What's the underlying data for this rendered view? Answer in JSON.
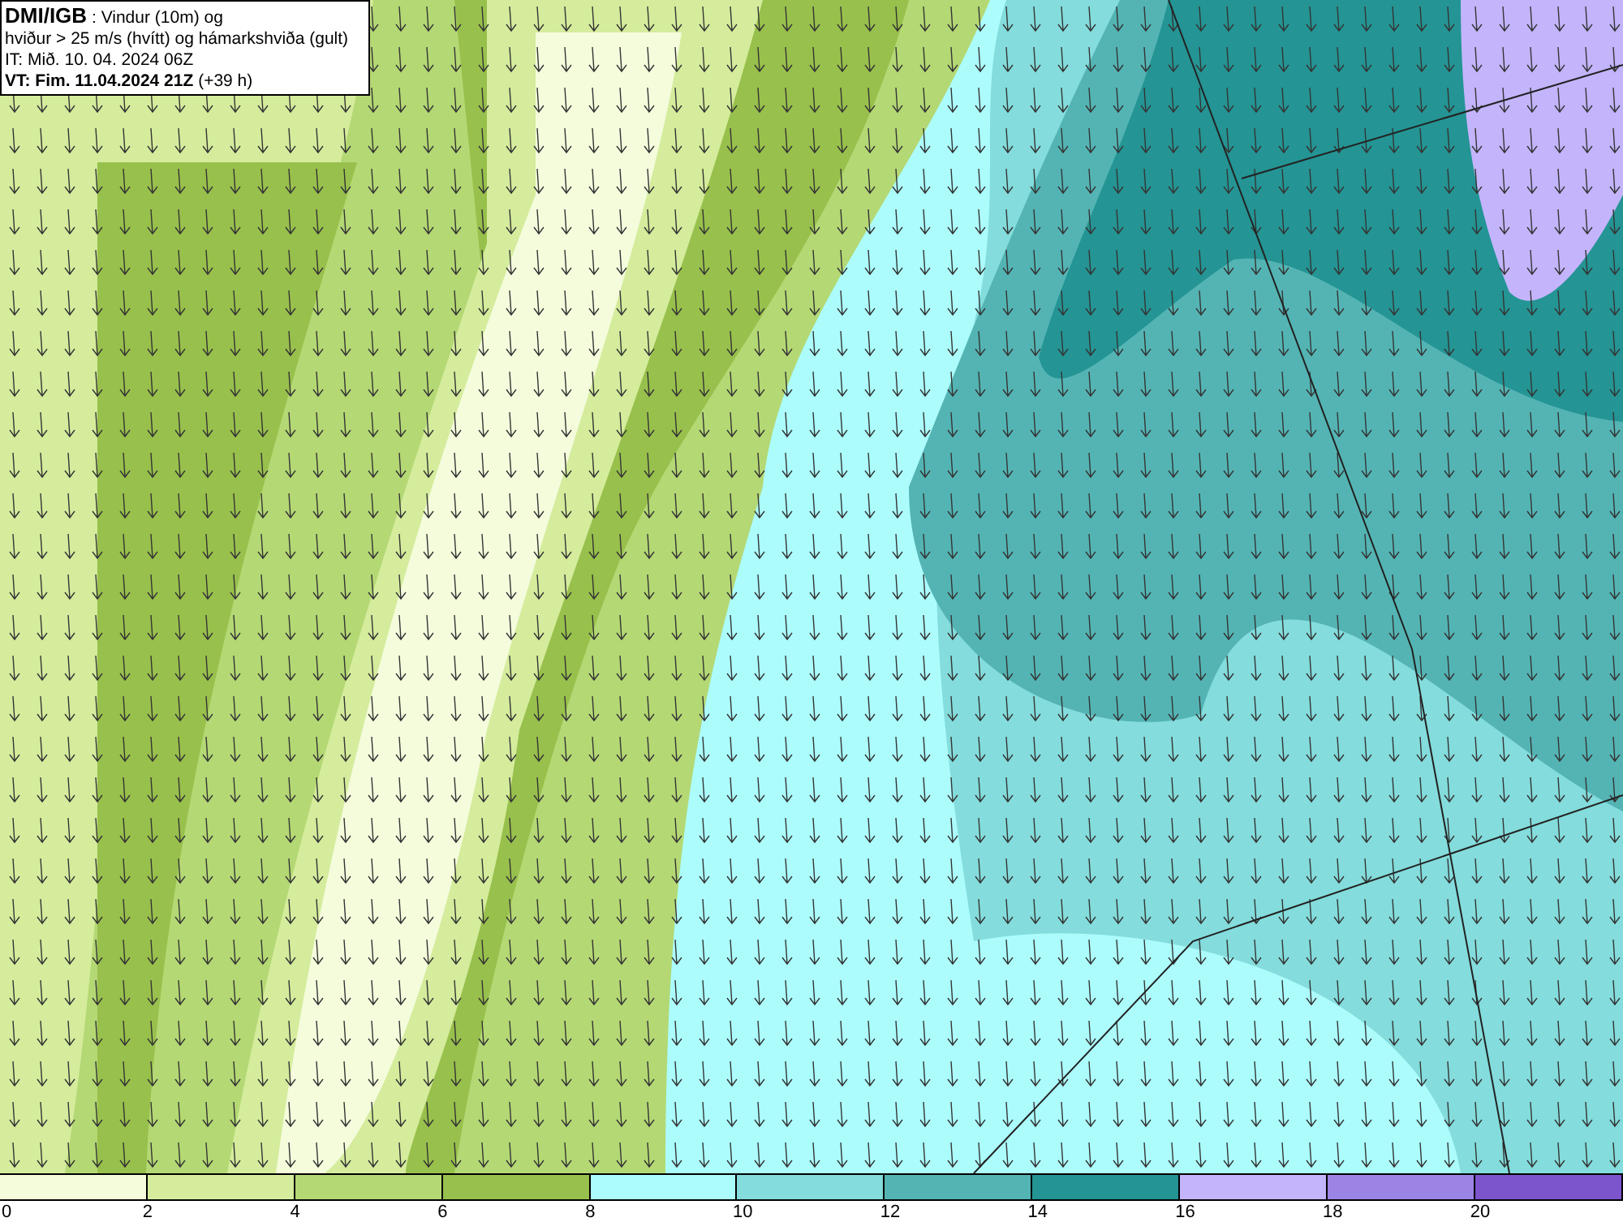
{
  "title_box": {
    "lines": [
      "**DMI/IGB** : Vindur (10m) og",
      "hviður > 25 m/s (hvítt) og hámarkshviða (gult)",
      "IT: Mið. 10. 04. 2024 06Z",
      "**VT: Fim. 11.04.2024 21Z** (+39 h)"
    ]
  },
  "legend": {
    "swatches": [
      {
        "color": "#f4fcdc"
      },
      {
        "color": "#d4ec9c"
      },
      {
        "color": "#b4d874"
      },
      {
        "color": "#98c04c"
      },
      {
        "color": "#acfcfc"
      },
      {
        "color": "#84dcdc"
      },
      {
        "color": "#54b4b4"
      },
      {
        "color": "#249494"
      },
      {
        "color": "#c4b4fc"
      },
      {
        "color": "#9c84e4"
      },
      {
        "color": "#7c54cc"
      }
    ],
    "ticks": [
      "0",
      "2",
      "4",
      "6",
      "8",
      "10",
      "12",
      "14",
      "16",
      "18",
      "20"
    ]
  }
}
